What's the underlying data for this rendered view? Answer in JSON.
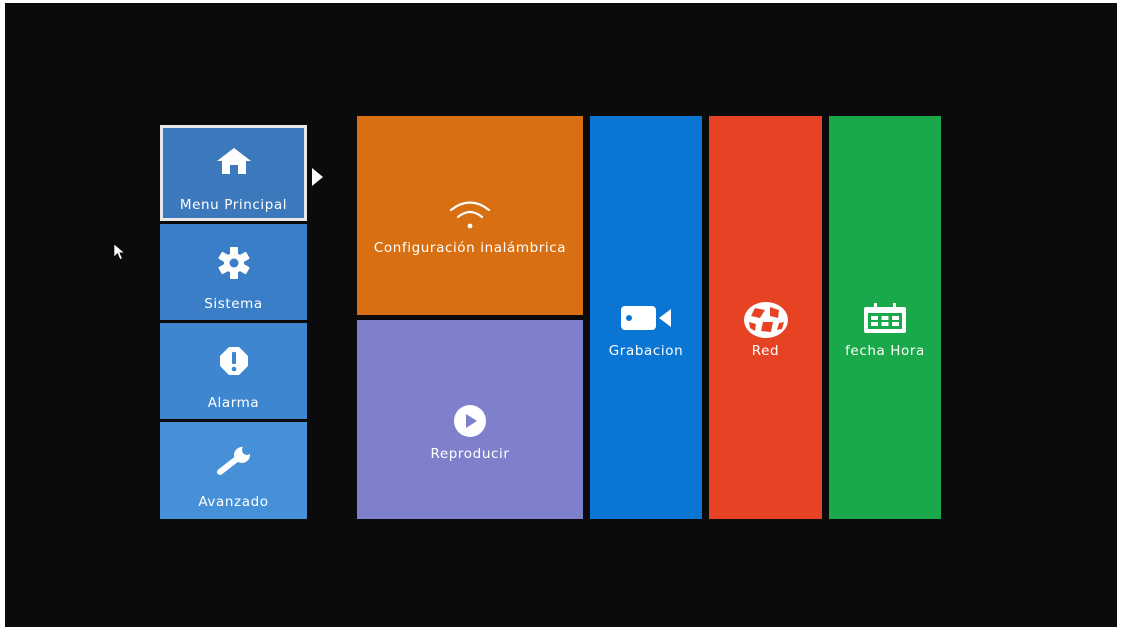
{
  "colors": {
    "background": "#0b0b0b",
    "menu_principal": "#3c78bc",
    "sistema": "#3b7ec8",
    "alarma": "#3e86cf",
    "avanzado": "#4690d8",
    "wireless": "#d86f12",
    "reproducir": "#7f80cc",
    "grabacion": "#0a75d2",
    "red": "#e64325",
    "fecha_hora": "#19a84a"
  },
  "sidebar": {
    "items": [
      {
        "label": "Menu Principal",
        "icon": "home-icon",
        "selected": true
      },
      {
        "label": "Sistema",
        "icon": "gear-icon"
      },
      {
        "label": "Alarma",
        "icon": "alarm-icon"
      },
      {
        "label": "Avanzado",
        "icon": "wrench-icon"
      }
    ]
  },
  "main": {
    "tiles": [
      {
        "label": "Configuración inalámbrica",
        "icon": "wifi-icon"
      },
      {
        "label": "Reproducir",
        "icon": "play-icon"
      },
      {
        "label": "Grabacion",
        "icon": "video-camera-icon"
      },
      {
        "label": "Red",
        "icon": "network-globe-icon"
      },
      {
        "label": "fecha Hora",
        "icon": "calendar-icon"
      }
    ]
  }
}
